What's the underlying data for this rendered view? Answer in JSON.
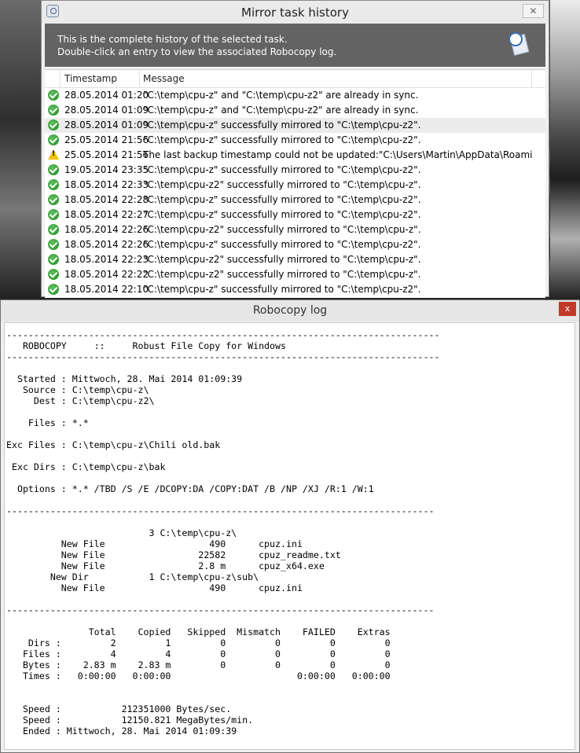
{
  "mirror_window": {
    "title": "Mirror task history",
    "close_label": "✕",
    "banner": {
      "line1": "This is the complete history of the selected task.",
      "line2": "Double-click an entry to view the associated Robocopy log."
    },
    "columns": {
      "timestamp": "Timestamp",
      "message": "Message"
    },
    "entries": [
      {
        "status": "success",
        "timestamp": "28.05.2014 01:20",
        "message": "\"C:\\temp\\cpu-z\" and \"C:\\temp\\cpu-z2\" are already in sync."
      },
      {
        "status": "success",
        "timestamp": "28.05.2014 01:09",
        "message": "\"C:\\temp\\cpu-z\" and \"C:\\temp\\cpu-z2\" are already in sync."
      },
      {
        "status": "success",
        "timestamp": "28.05.2014 01:09",
        "message": "\"C:\\temp\\cpu-z\" successfully mirrored to \"C:\\temp\\cpu-z2\".",
        "selected": true
      },
      {
        "status": "success",
        "timestamp": "25.05.2014 21:56",
        "message": "\"C:\\temp\\cpu-z\" successfully mirrored to \"C:\\temp\\cpu-z2\"."
      },
      {
        "status": "warning",
        "timestamp": "25.05.2014 21:56",
        "message": "The last backup timestamp could not be updated:\"C:\\Users\\Martin\\AppData\\Roaming\\Ro..."
      },
      {
        "status": "success",
        "timestamp": "19.05.2014 23:35",
        "message": "\"C:\\temp\\cpu-z\" successfully mirrored to \"C:\\temp\\cpu-z2\"."
      },
      {
        "status": "success",
        "timestamp": "18.05.2014 22:33",
        "message": "\"C:\\temp\\cpu-z2\" successfully mirrored to \"C:\\temp\\cpu-z\"."
      },
      {
        "status": "success",
        "timestamp": "18.05.2014 22:28",
        "message": "\"C:\\temp\\cpu-z\" successfully mirrored to \"C:\\temp\\cpu-z2\"."
      },
      {
        "status": "success",
        "timestamp": "18.05.2014 22:27",
        "message": "\"C:\\temp\\cpu-z\" successfully mirrored to \"C:\\temp\\cpu-z2\"."
      },
      {
        "status": "success",
        "timestamp": "18.05.2014 22:26",
        "message": "\"C:\\temp\\cpu-z2\" successfully mirrored to \"C:\\temp\\cpu-z\"."
      },
      {
        "status": "success",
        "timestamp": "18.05.2014 22:26",
        "message": "\"C:\\temp\\cpu-z\" successfully mirrored to \"C:\\temp\\cpu-z2\"."
      },
      {
        "status": "success",
        "timestamp": "18.05.2014 22:23",
        "message": "\"C:\\temp\\cpu-z2\" successfully mirrored to \"C:\\temp\\cpu-z\"."
      },
      {
        "status": "success",
        "timestamp": "18.05.2014 22:22",
        "message": "\"C:\\temp\\cpu-z2\" successfully mirrored to \"C:\\temp\\cpu-z\"."
      },
      {
        "status": "success",
        "timestamp": "18.05.2014 22:10",
        "message": "\"C:\\temp\\cpu-z\" successfully mirrored to \"C:\\temp\\cpu-z2\"."
      }
    ]
  },
  "log_window": {
    "title": "Robocopy log",
    "close_label": "x",
    "lines": [
      "-------------------------------------------------------------------------------",
      "   ROBOCOPY     ::     Robust File Copy for Windows                              ",
      "-------------------------------------------------------------------------------",
      "",
      "  Started : Mittwoch, 28. Mai 2014 01:09:39",
      "   Source : C:\\temp\\cpu-z\\",
      "     Dest : C:\\temp\\cpu-z2\\",
      "",
      "    Files : *.*",
      "",
      "Exc Files : C:\\temp\\cpu-z\\Chili old.bak",
      "",
      " Exc Dirs : C:\\temp\\cpu-z\\bak",
      "",
      "  Options : *.* /TBD /S /E /DCOPY:DA /COPY:DAT /B /NP /XJ /R:1 /W:1",
      "",
      "------------------------------------------------------------------------------",
      "",
      "                          3 C:\\temp\\cpu-z\\",
      "          New File                   490      cpuz.ini",
      "          New File                 22582      cpuz_readme.txt",
      "          New File                 2.8 m      cpuz_x64.exe",
      "        New Dir           1 C:\\temp\\cpu-z\\sub\\",
      "          New File                   490      cpuz.ini",
      "",
      "------------------------------------------------------------------------------",
      "",
      "               Total    Copied   Skipped  Mismatch    FAILED    Extras",
      "    Dirs :         2         1         0         0         0         0",
      "   Files :         4         4         0         0         0         0",
      "   Bytes :    2.83 m    2.83 m         0         0         0         0",
      "   Times :   0:00:00   0:00:00                       0:00:00   0:00:00",
      "",
      "",
      "   Speed :           212351000 Bytes/sec.",
      "   Speed :           12150.821 MegaBytes/min.",
      "   Ended : Mittwoch, 28. Mai 2014 01:09:39"
    ]
  }
}
